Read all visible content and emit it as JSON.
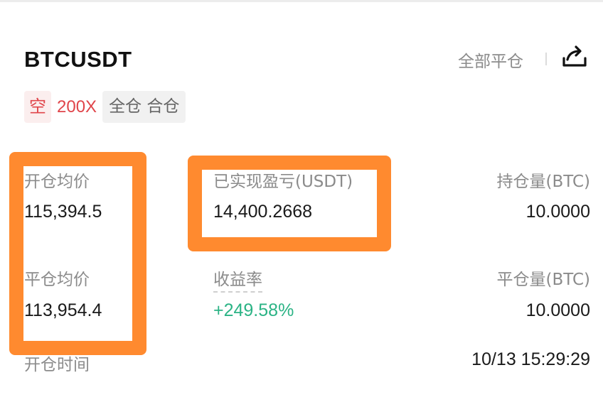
{
  "position": {
    "symbol": "BTCUSDT",
    "close_all_label": "全部平仓",
    "share_icon": "share-icon",
    "tags": {
      "side": "空",
      "leverage": "200X",
      "margin_mode": "全仓 合仓"
    }
  },
  "stats": {
    "open_avg_price": {
      "label": "开仓均价",
      "value": "115,394.5"
    },
    "realized_pnl": {
      "label": "已实现盈亏(USDT)",
      "value": "14,400.2668"
    },
    "position_size": {
      "label": "持仓量(BTC)",
      "value": "10.0000"
    },
    "close_avg_price": {
      "label": "平仓均价",
      "value": "113,954.4"
    },
    "roi": {
      "label": "收益率",
      "value": "+249.58%"
    },
    "closed_size": {
      "label": "平仓量(BTC)",
      "value": "10.0000"
    },
    "open_time": {
      "label": "开仓时间",
      "value": "10/13 15:29:29"
    }
  },
  "colors": {
    "short": "#e0454a",
    "profit": "#2bb385",
    "highlight": "#ff8a2f"
  }
}
